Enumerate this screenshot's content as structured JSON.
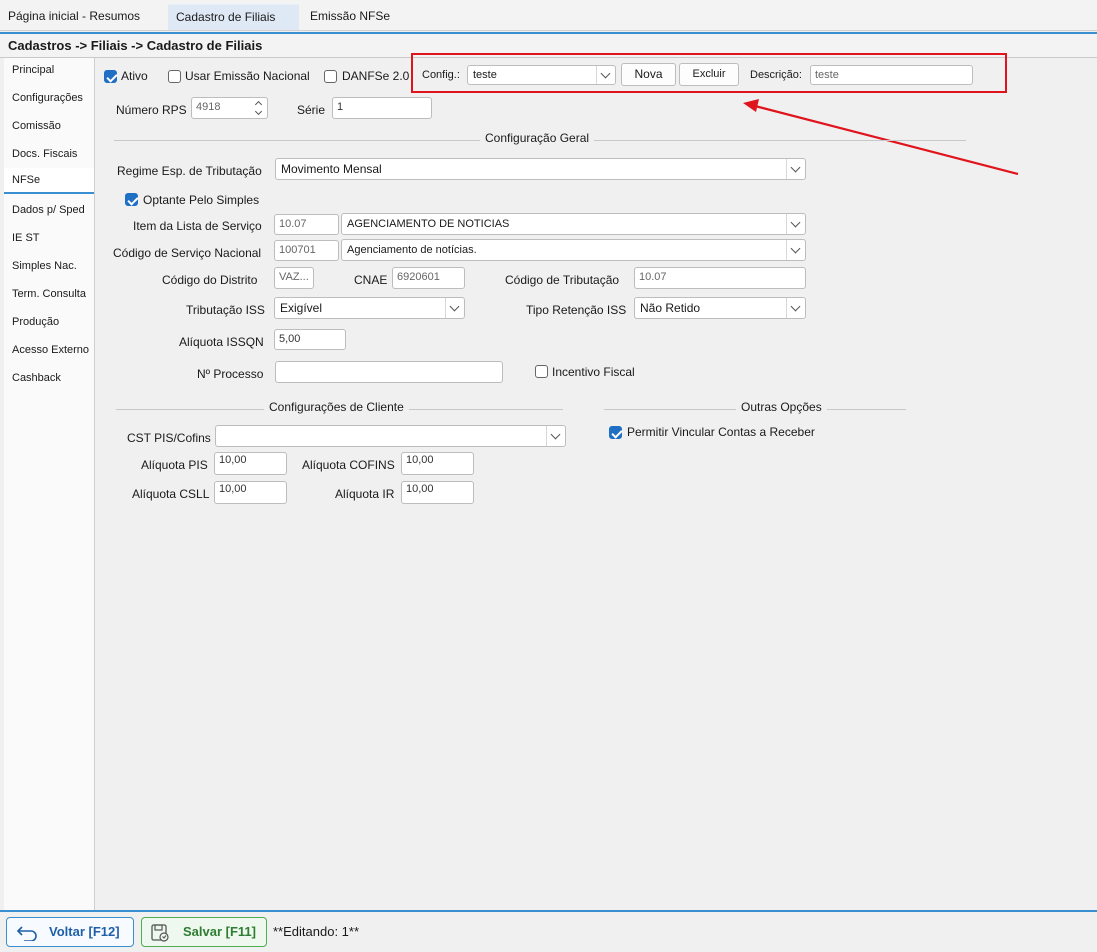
{
  "tabs": [
    {
      "label": "Página inicial - Resumos"
    },
    {
      "label": "Cadastro de Filiais"
    },
    {
      "label": "Emissão NFSe"
    }
  ],
  "breadcrumb": "Cadastros -> Filiais -> Cadastro de Filiais",
  "sidebar": {
    "items": [
      {
        "label": "Principal"
      },
      {
        "label": "Configurações"
      },
      {
        "label": "Comissão"
      },
      {
        "label": "Docs. Fiscais"
      },
      {
        "label": "NFSe"
      },
      {
        "label": "Dados p/ Sped"
      },
      {
        "label": "IE ST"
      },
      {
        "label": "Simples Nac."
      },
      {
        "label": "Term. Consulta"
      },
      {
        "label": "Produção"
      },
      {
        "label": "Acesso Externo"
      },
      {
        "label": "Cashback"
      }
    ],
    "active_index": 4
  },
  "top": {
    "ativo_label": "Ativo",
    "ativo_checked": true,
    "emissao_nacional_label": "Usar Emissão Nacional",
    "emissao_nacional_checked": false,
    "danfse_label": "DANFSe 2.0",
    "danfse_checked": false,
    "config_label": "Config.:",
    "config_value": "teste",
    "nova_label": "Nova",
    "excluir_label": "Excluir",
    "descricao_label": "Descrição:",
    "descricao_value": "teste",
    "numero_rps_label": "Número RPS",
    "numero_rps_value": "4918",
    "serie_label": "Série",
    "serie_value": "1"
  },
  "config_geral": {
    "title": "Configuração Geral",
    "regime_label": "Regime Esp. de Tributação",
    "regime_value": "Movimento Mensal",
    "optante_label": "Optante Pelo Simples",
    "optante_checked": true,
    "item_lista_label": "Item da Lista de Serviço",
    "item_lista_code": "10.07",
    "item_lista_value": "AGENCIAMENTO DE NOTICIAS",
    "cod_nacional_label": "Código de Serviço Nacional",
    "cod_nacional_code": "100701",
    "cod_nacional_value": "Agenciamento de notícias.",
    "cod_distrito_label": "Código do Distrito",
    "cod_distrito_value": "VAZ...",
    "cnae_label": "CNAE",
    "cnae_value": "6920601",
    "cod_tributacao_label": "Código de Tributação",
    "cod_tributacao_value": "10.07",
    "trib_iss_label": "Tributação ISS",
    "trib_iss_value": "Exigível",
    "tipo_ret_label": "Tipo Retenção ISS",
    "tipo_ret_value": "Não Retido",
    "aliq_issqn_label": "Alíquota ISSQN",
    "aliq_issqn_value": "5,00",
    "num_processo_label": "Nº Processo",
    "num_processo_value": "",
    "incentivo_label": "Incentivo Fiscal",
    "incentivo_checked": false
  },
  "config_cliente": {
    "title": "Configurações de Cliente",
    "cst_label": "CST PIS/Cofins",
    "cst_value": "",
    "aliq_pis_label": "Alíquota PIS",
    "aliq_pis_value": "10,00",
    "aliq_cofins_label": "Alíquota COFINS",
    "aliq_cofins_value": "10,00",
    "aliq_csll_label": "Alíquota CSLL",
    "aliq_csll_value": "10,00",
    "aliq_ir_label": "Alíquota IR",
    "aliq_ir_value": "10,00"
  },
  "outras_opcoes": {
    "title": "Outras Opções",
    "permitir_label": "Permitir Vincular Contas a Receber",
    "permitir_checked": true
  },
  "footer": {
    "voltar_label": "Voltar [F12]",
    "salvar_label": "Salvar [F11]",
    "status_text": "**Editando: 1**"
  },
  "colors": {
    "accent": "#3a8fd0",
    "annotation": "#e0141c",
    "salvar": "#2e7d32",
    "voltar": "#1f5fa8"
  }
}
